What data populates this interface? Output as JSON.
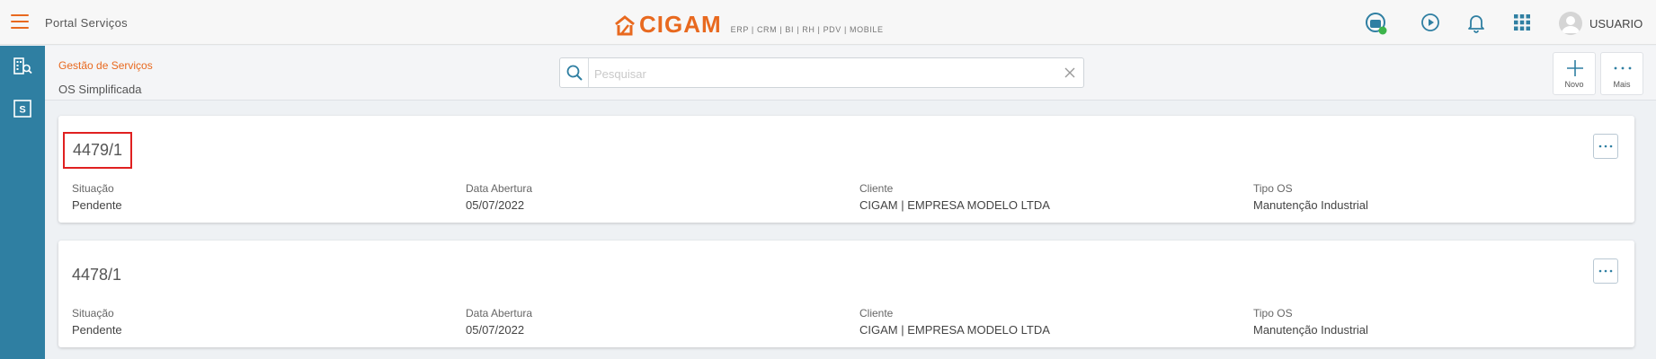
{
  "topbar": {
    "app_title": "Portal Serviços",
    "logo_text": "CIGAM",
    "logo_subtitle": "ERP | CRM | BI | RH | PDV | MOBILE",
    "user_name": "USUARIO"
  },
  "header": {
    "breadcrumb": "Gestão de Serviços",
    "page_title": "OS Simplificada",
    "search_placeholder": "Pesquisar",
    "novo_label": "Novo",
    "mais_label": "Mais"
  },
  "labels": {
    "situacao": "Situação",
    "data_abertura": "Data Abertura",
    "cliente": "Cliente",
    "tipo_os": "Tipo OS"
  },
  "orders": [
    {
      "id": "4479/1",
      "situacao": "Pendente",
      "data_abertura": "05/07/2022",
      "cliente": "CIGAM | EMPRESA MODELO LTDA",
      "tipo_os": "Manutenção Industrial"
    },
    {
      "id": "4478/1",
      "situacao": "Pendente",
      "data_abertura": "05/07/2022",
      "cliente": "CIGAM | EMPRESA MODELO LTDA",
      "tipo_os": "Manutenção Industrial"
    }
  ],
  "colors": {
    "brand_orange": "#e8691f",
    "sidebar_blue": "#2f7fa2",
    "highlight_red": "#e02020",
    "status_online": "#3cb44b"
  }
}
